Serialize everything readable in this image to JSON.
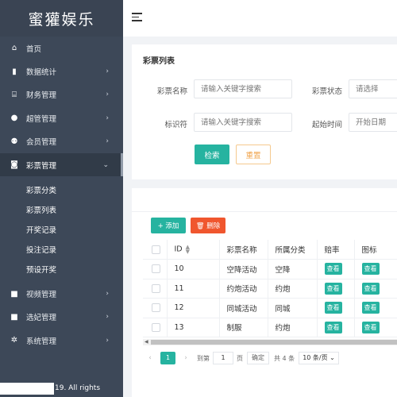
{
  "brand": "蜜獾娱乐",
  "sidebar": {
    "items": [
      {
        "label": "首页",
        "icon": "home-icon",
        "glyph": "⌂",
        "arrow": ""
      },
      {
        "label": "数据统计",
        "icon": "bar-chart-icon",
        "glyph": "▮",
        "arrow": "›"
      },
      {
        "label": "财务管理",
        "icon": "bank-icon",
        "glyph": "⌸",
        "arrow": "›"
      },
      {
        "label": "超管管理",
        "icon": "user-icon",
        "glyph": "●",
        "arrow": "›"
      },
      {
        "label": "会员管理",
        "icon": "users-icon",
        "glyph": "⚉",
        "arrow": "›"
      },
      {
        "label": "彩票管理",
        "icon": "gamepad-icon",
        "glyph": "◙",
        "arrow": "⌄"
      }
    ],
    "submenu": [
      "彩票分类",
      "彩票列表",
      "开奖记录",
      "投注记录",
      "预设开奖"
    ],
    "items_after": [
      {
        "label": "视频管理",
        "icon": "video-icon",
        "glyph": "■",
        "arrow": "›"
      },
      {
        "label": "选妃管理",
        "icon": "camera-icon",
        "glyph": "■",
        "arrow": "›"
      },
      {
        "label": "系统管理",
        "icon": "gear-icon",
        "glyph": "✲",
        "arrow": "›"
      }
    ],
    "footer": "19. All rights"
  },
  "search": {
    "title": "彩票列表",
    "name_label": "彩票名称",
    "name_placeholder": "请输入关键字搜索",
    "status_label": "彩票状态",
    "status_placeholder": "请选择",
    "code_label": "标识符",
    "code_placeholder": "请输入关键字搜索",
    "start_label": "起始时间",
    "start_placeholder": "开始日期",
    "search_button": "检索",
    "reset_button": "重置"
  },
  "table": {
    "add_button": "+ 添加",
    "delete_button": "🗑 删除",
    "headers": {
      "id": "ID",
      "name": "彩票名称",
      "category": "所属分类",
      "odds": "赔率",
      "icon": "图标"
    },
    "rows": [
      {
        "id": "10",
        "name": "空降活动",
        "category": "空降",
        "odds": "查看",
        "icon": "查看"
      },
      {
        "id": "11",
        "name": "约炮活动",
        "category": "约炮",
        "odds": "查看",
        "icon": "查看"
      },
      {
        "id": "12",
        "name": "同城活动",
        "category": "同城",
        "odds": "查看",
        "icon": "查看"
      },
      {
        "id": "13",
        "name": "制服",
        "category": "约炮",
        "odds": "查看",
        "icon": "查看"
      }
    ]
  },
  "pager": {
    "current": "1",
    "goto_label": "到第",
    "goto_value": "1",
    "page_unit": "页",
    "confirm": "确定",
    "total": "共 4 条",
    "page_size": "10 条/页 ⌄"
  }
}
